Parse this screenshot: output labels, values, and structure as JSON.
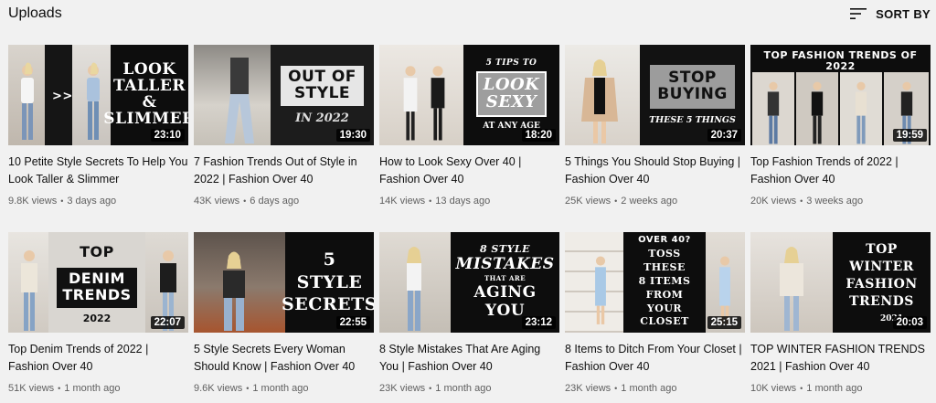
{
  "header": {
    "title": "Uploads",
    "sort_label": "SORT BY",
    "sort_icon": "sort-icon"
  },
  "videos": [
    {
      "title": "10 Petite Style Secrets To Help You Look Taller & Slimmer",
      "views": "9.8K views",
      "age": "3 days ago",
      "duration": "23:10",
      "thumb_text": "LOOK\nTALLER\n&\nSLIMMER",
      "arrow": ">>"
    },
    {
      "title": "7 Fashion Trends Out of Style in 2022 | Fashion Over 40",
      "views": "43K views",
      "age": "6 days ago",
      "duration": "19:30",
      "thumb_text": "OUT OF\nSTYLE",
      "thumb_sub": "IN 2022"
    },
    {
      "title": "How to Look Sexy Over 40 | Fashion Over 40",
      "views": "14K views",
      "age": "13 days ago",
      "duration": "18:20",
      "thumb_small": "5 TIPS TO",
      "thumb_text": "LOOK\nSEXY",
      "thumb_sub": "AT ANY AGE"
    },
    {
      "title": "5 Things You Should Stop Buying | Fashion Over 40",
      "views": "25K views",
      "age": "2 weeks ago",
      "duration": "20:37",
      "thumb_text": "STOP\nBUYING",
      "thumb_sub": "THESE 5 THINGS"
    },
    {
      "title": "Top Fashion Trends of 2022 | Fashion Over 40",
      "views": "20K views",
      "age": "3 weeks ago",
      "duration": "19:59",
      "thumb_text": "TOP FASHION TRENDS OF 2022"
    },
    {
      "title": "Top Denim Trends of 2022 | Fashion Over 40",
      "views": "51K views",
      "age": "1 month ago",
      "duration": "22:07",
      "thumb_text": "TOP",
      "thumb_mid": "DENIM\nTRENDS",
      "thumb_sub": "2022"
    },
    {
      "title": "5 Style Secrets Every Woman Should Know | Fashion Over 40",
      "views": "9.6K views",
      "age": "1 month ago",
      "duration": "22:55",
      "thumb_text": "5\nSTYLE\nSECRETS"
    },
    {
      "title": "8 Style Mistakes That Are Aging You | Fashion Over 40",
      "views": "23K views",
      "age": "1 month ago",
      "duration": "23:12",
      "thumb_small": "8 STYLE",
      "thumb_text": "MISTAKES",
      "thumb_tiny": "THAT ARE",
      "thumb_mid": "AGING\nYOU"
    },
    {
      "title": "8 Items to Ditch From Your Closet | Fashion Over 40",
      "views": "23K views",
      "age": "1 month ago",
      "duration": "25:15",
      "thumb_small": "OVER 40?",
      "thumb_text": "TOSS THESE\n8 ITEMS\nFROM\nYOUR\nCLOSET"
    },
    {
      "title": "TOP WINTER FASHION TRENDS 2021 | Fashion Over 40",
      "views": "10K views",
      "age": "1 month ago",
      "duration": "20:03",
      "thumb_text": "TOP\nWINTER\nFASHION\nTRENDS",
      "thumb_sub": "2021"
    }
  ]
}
